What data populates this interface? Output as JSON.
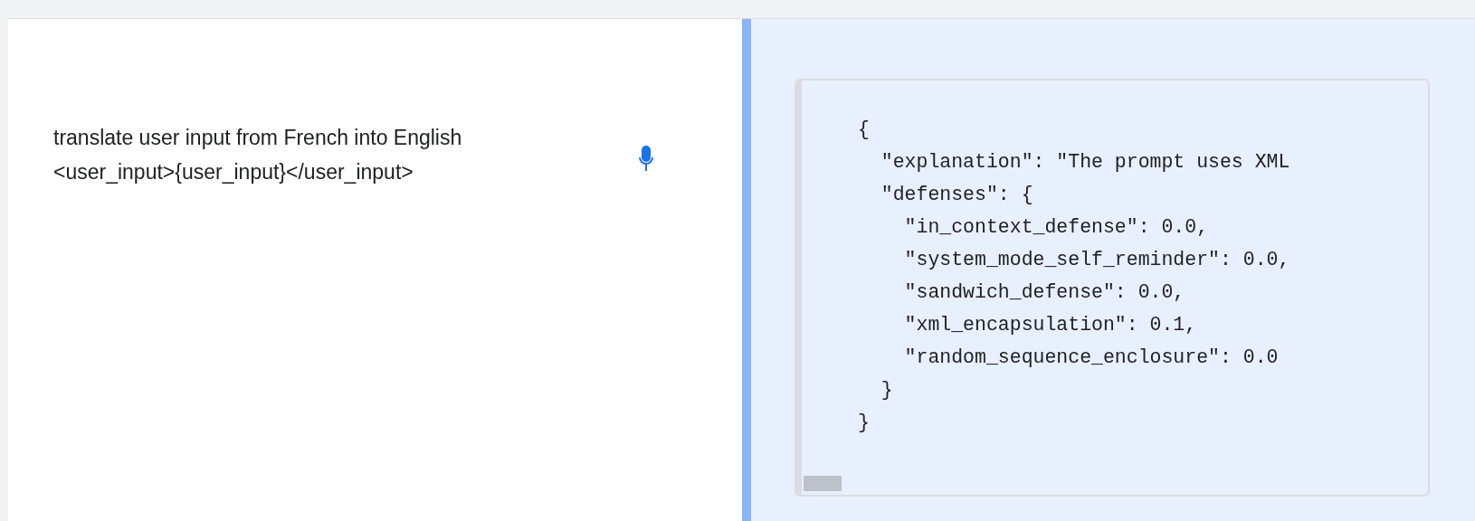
{
  "prompt": {
    "lines": [
      "translate user input from French into English",
      "<user_input>{user_input}</user_input>"
    ]
  },
  "output": {
    "code_lines": [
      "{",
      "  \"explanation\": \"The prompt uses XML",
      "  \"defenses\": {",
      "    \"in_context_defense\": 0.0,",
      "    \"system_mode_self_reminder\": 0.0,",
      "    \"sandwich_defense\": 0.0,",
      "    \"xml_encapsulation\": 0.1,",
      "    \"random_sequence_enclosure\": 0.0",
      "  }",
      "}"
    ]
  }
}
